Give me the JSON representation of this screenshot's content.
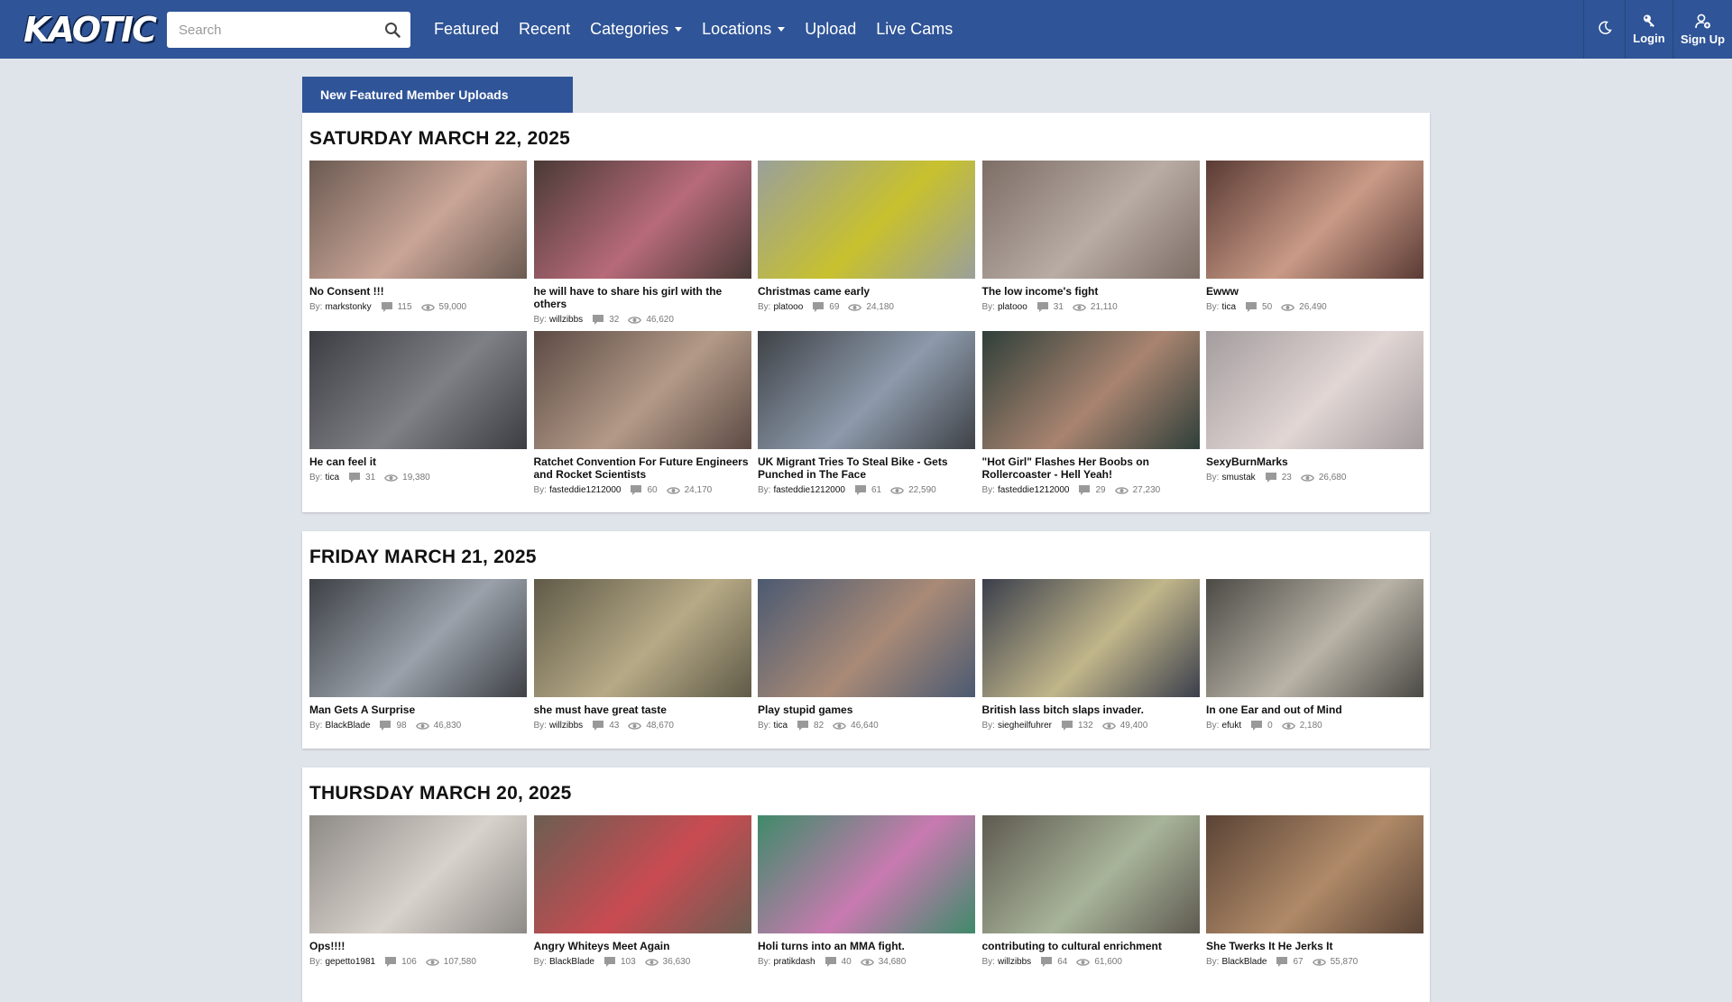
{
  "brand": {
    "logo_text": "KAOTIC",
    "accent": "#2f5497"
  },
  "search": {
    "placeholder": "Search",
    "icon": "search-icon"
  },
  "nav": {
    "links": [
      "Featured",
      "Recent",
      "Categories",
      "Locations",
      "Upload",
      "Live Cams"
    ],
    "theme_icon": "moon-icon",
    "login_label": "Login",
    "signup_label": "Sign Up"
  },
  "feature_tab": "New Featured Member Uploads",
  "by_label": "By:",
  "sections": [
    {
      "date": "SATURDAY MARCH 22, 2025",
      "videos": [
        {
          "title": "No Consent !!!",
          "author": "markstonky",
          "comments": "115",
          "views": "59,000",
          "thumb": [
            "#6b5a52",
            "#c9a597"
          ]
        },
        {
          "title": "he will have to share his girl with the others",
          "author": "willzibbs",
          "comments": "32",
          "views": "46,620",
          "thumb": [
            "#4a3a36",
            "#b76a7a"
          ]
        },
        {
          "title": "Christmas came early",
          "author": "platooo",
          "comments": "69",
          "views": "24,180",
          "thumb": [
            "#9aa09a",
            "#c8c12e"
          ]
        },
        {
          "title": "The low income's fight",
          "author": "platooo",
          "comments": "31",
          "views": "21,110",
          "thumb": [
            "#7d6e66",
            "#b8aca4"
          ]
        },
        {
          "title": "Ewww",
          "author": "tica",
          "comments": "50",
          "views": "26,490",
          "thumb": [
            "#5a3b35",
            "#c99a86"
          ]
        },
        {
          "title": "He can feel it",
          "author": "tica",
          "comments": "31",
          "views": "19,380",
          "thumb": [
            "#3c3d42",
            "#7f7f86"
          ]
        },
        {
          "title": "Ratchet Convention For Future Engineers and Rocket Scientists",
          "author": "fasteddie1212000",
          "comments": "60",
          "views": "24,170",
          "thumb": [
            "#5c4a44",
            "#b39a88"
          ]
        },
        {
          "title": "UK Migrant Tries To Steal Bike - Gets Punched in The Face",
          "author": "fasteddie1212000",
          "comments": "61",
          "views": "22,590",
          "thumb": [
            "#3f4247",
            "#8d9aab"
          ]
        },
        {
          "title": "\"Hot Girl\" Flashes Her Boobs on Rollercoaster - Hell Yeah!",
          "author": "fasteddie1212000",
          "comments": "29",
          "views": "27,230",
          "thumb": [
            "#2f3f3a",
            "#a98470"
          ]
        },
        {
          "title": "SexyBurnMarks",
          "author": "smustak",
          "comments": "23",
          "views": "26,680",
          "thumb": [
            "#a49c9e",
            "#e1d6d4"
          ]
        }
      ]
    },
    {
      "date": "FRIDAY MARCH 21, 2025",
      "videos": [
        {
          "title": "Man Gets A Surprise",
          "author": "BlackBlade",
          "comments": "98",
          "views": "46,830",
          "thumb": [
            "#3e4146",
            "#9aa1aa"
          ]
        },
        {
          "title": "she must have great taste",
          "author": "willzibbs",
          "comments": "43",
          "views": "48,670",
          "thumb": [
            "#5f5a48",
            "#b7aa86"
          ]
        },
        {
          "title": "Play stupid games",
          "author": "tica",
          "comments": "82",
          "views": "46,640",
          "thumb": [
            "#4b5a72",
            "#a98a76"
          ]
        },
        {
          "title": "British lass bitch slaps invader.",
          "author": "siegheilfuhrer",
          "comments": "132",
          "views": "49,400",
          "thumb": [
            "#3b3f4c",
            "#c1b68a"
          ]
        },
        {
          "title": "In one Ear and out of Mind",
          "author": "efukt",
          "comments": "0",
          "views": "2,180",
          "thumb": [
            "#4b4a45",
            "#b9b3a7"
          ]
        }
      ]
    },
    {
      "date": "THURSDAY MARCH 20, 2025",
      "videos": [
        {
          "title": "Ops!!!!",
          "author": "gepetto1981",
          "comments": "106",
          "views": "107,580",
          "thumb": [
            "#8e8a86",
            "#d8d2cc"
          ]
        },
        {
          "title": "Angry Whiteys Meet Again",
          "author": "BlackBlade",
          "comments": "103",
          "views": "36,630",
          "thumb": [
            "#6b5e52",
            "#c94b52"
          ]
        },
        {
          "title": "Holi turns into an MMA fight.",
          "author": "pratikdash",
          "comments": "40",
          "views": "34,680",
          "thumb": [
            "#3f8a6a",
            "#c87ab0"
          ]
        },
        {
          "title": "contributing to cultural enrichment",
          "author": "willzibbs",
          "comments": "64",
          "views": "61,600",
          "thumb": [
            "#5e5a50",
            "#a8b49a"
          ]
        },
        {
          "title": "She Twerks It He Jerks It",
          "author": "BlackBlade",
          "comments": "67",
          "views": "55,870",
          "thumb": [
            "#5a4436",
            "#b08a68"
          ]
        }
      ]
    }
  ]
}
